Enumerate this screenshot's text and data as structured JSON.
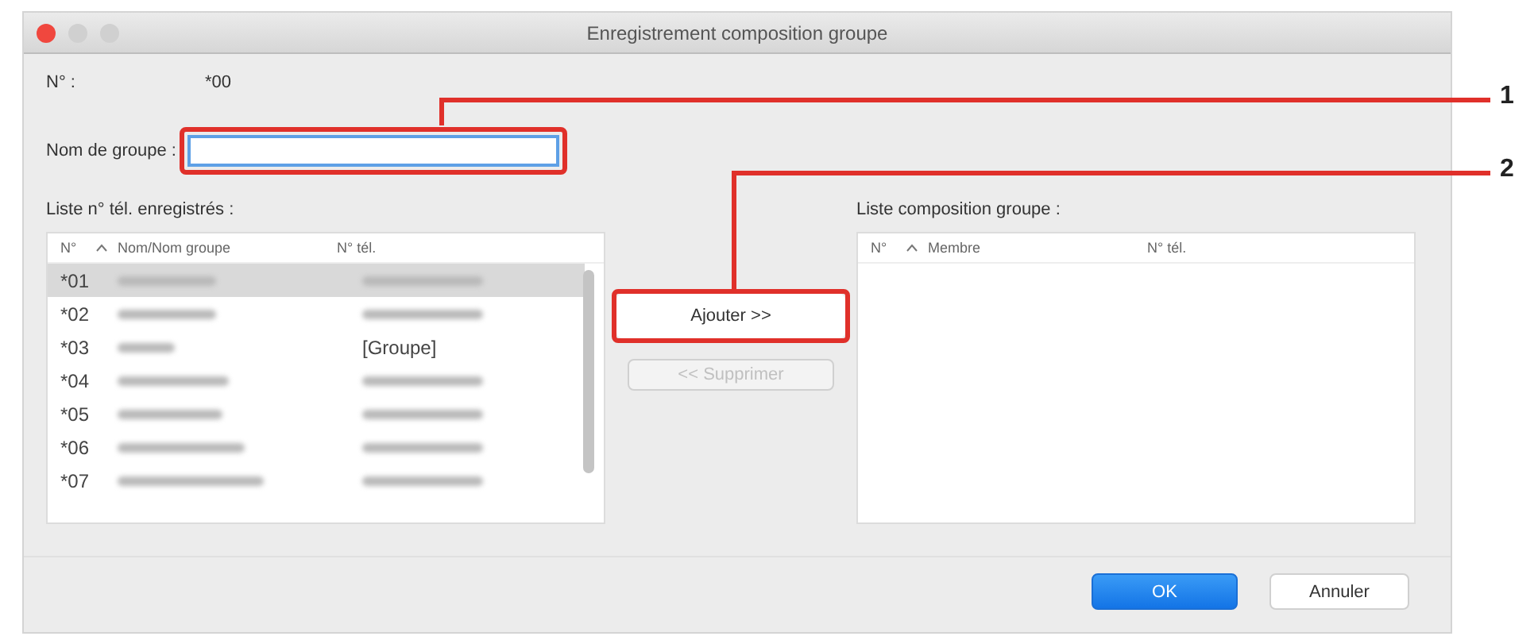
{
  "window": {
    "title": "Enregistrement composition groupe"
  },
  "number_label": "N° :",
  "number_value": "*00",
  "group_name": {
    "label": "Nom de groupe :"
  },
  "registered_list": {
    "label": "Liste n° tél. enregistrés :",
    "columns": [
      "N°",
      "Nom/Nom groupe",
      "N° tél."
    ],
    "rows": [
      {
        "number": "*01",
        "kind": "contact",
        "selected": true
      },
      {
        "number": "*02",
        "kind": "contact",
        "selected": false
      },
      {
        "number": "*03",
        "kind": "group",
        "phone": "[Groupe]",
        "selected": false
      },
      {
        "number": "*04",
        "kind": "contact",
        "selected": false
      },
      {
        "number": "*05",
        "kind": "contact",
        "selected": false
      },
      {
        "number": "*06",
        "kind": "contact",
        "selected": false
      },
      {
        "number": "*07",
        "kind": "contact",
        "selected": false
      }
    ]
  },
  "add_button": {
    "label": "Ajouter >>",
    "disabled": false
  },
  "remove_button": {
    "label": "<< Supprimer",
    "disabled": true
  },
  "members_list": {
    "label": "Liste composition groupe :",
    "columns": [
      "N°",
      "Membre",
      "N° tél."
    ]
  },
  "ok_button": "OK",
  "cancel_button": "Annuler",
  "callouts": [
    {
      "label": "1"
    },
    {
      "label": "2"
    }
  ]
}
